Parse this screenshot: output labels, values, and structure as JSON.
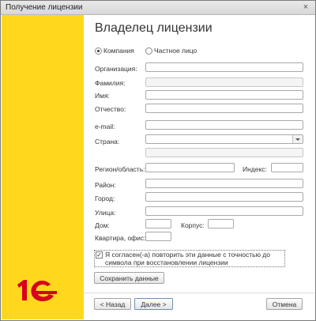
{
  "window": {
    "title": "Получение лицензии",
    "close_glyph": "×"
  },
  "page": {
    "heading": "Владелец лицензии"
  },
  "owner_type": {
    "option_company": "Компания",
    "option_private": "Частное лицо",
    "selected": "Компания"
  },
  "form": {
    "organization_label": "Организация:",
    "lastname_label": "Фамилия:",
    "firstname_label": "Имя:",
    "middlename_label": "Отчество:",
    "email_label": "e-mail:",
    "country_label": "Страна:",
    "region_label": "Регион/область:",
    "index_label": "Индекс:",
    "district_label": "Район:",
    "city_label": "Город:",
    "street_label": "Улица:",
    "house_label": "Дом:",
    "building_label": "Корпус:",
    "apartment_label": "Квартира, офис:"
  },
  "agreement": {
    "text": "Я согласен(-а) повторить эти данные с точностью до символа при восстановлении лицензии",
    "checked": true,
    "check_glyph": "✓"
  },
  "buttons": {
    "save": "Сохранить данные",
    "back": "< Назад",
    "next": "Далее >",
    "cancel": "Отмена"
  },
  "brand": {
    "logo": "1С",
    "color": "#d6001c",
    "sidebar_color": "#ffd81d"
  }
}
